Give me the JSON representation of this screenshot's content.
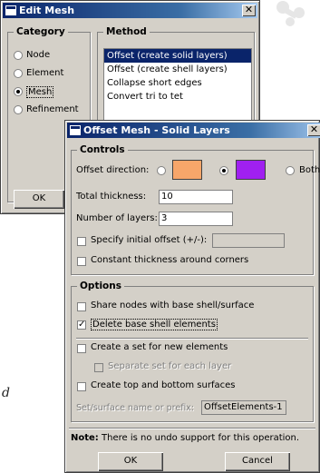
{
  "edit_mesh": {
    "title": "Edit Mesh",
    "close": "✕",
    "category_label": "Category",
    "categories": [
      "Node",
      "Element",
      "Mesh",
      "Refinement"
    ],
    "category_selected": "Mesh",
    "method_label": "Method",
    "methods": [
      "Offset (create solid layers)",
      "Offset (create shell layers)",
      "Collapse short edges",
      "Convert tri to tet"
    ],
    "method_selected": "Offset (create solid layers)",
    "ok_label": "OK"
  },
  "offset_dialog": {
    "title": "Offset Mesh - Solid Layers",
    "close": "✕",
    "controls_label": "Controls",
    "offset_direction_label": "Offset direction:",
    "direction_colors": [
      "#f7a66a",
      "#a020f0"
    ],
    "direction_both": "Both",
    "direction_selected": 1,
    "total_thickness_label": "Total thickness:",
    "total_thickness_value": "10",
    "num_layers_label": "Number of layers:",
    "num_layers_value": "3",
    "initial_offset_label": "Specify initial offset (+/-):",
    "initial_offset_checked": false,
    "constant_thickness_label": "Constant thickness around corners",
    "constant_thickness_checked": false,
    "options_label": "Options",
    "share_nodes_label": "Share nodes with base shell/surface",
    "share_nodes_checked": false,
    "delete_shell_label": "Delete base shell elements",
    "delete_shell_checked": true,
    "create_set_label": "Create a set for new elements",
    "create_set_checked": false,
    "separate_set_label": "Separate set for each layer",
    "create_surfaces_label": "Create top and bottom surfaces",
    "create_surfaces_checked": false,
    "set_name_label": "Set/surface name or prefix:",
    "set_name_value": "OffsetElements-1",
    "note_bold": "Note:",
    "note_text": "There is no undo support for this operation.",
    "ok_label": "OK",
    "cancel_label": "Cancel"
  },
  "background_text": "d"
}
